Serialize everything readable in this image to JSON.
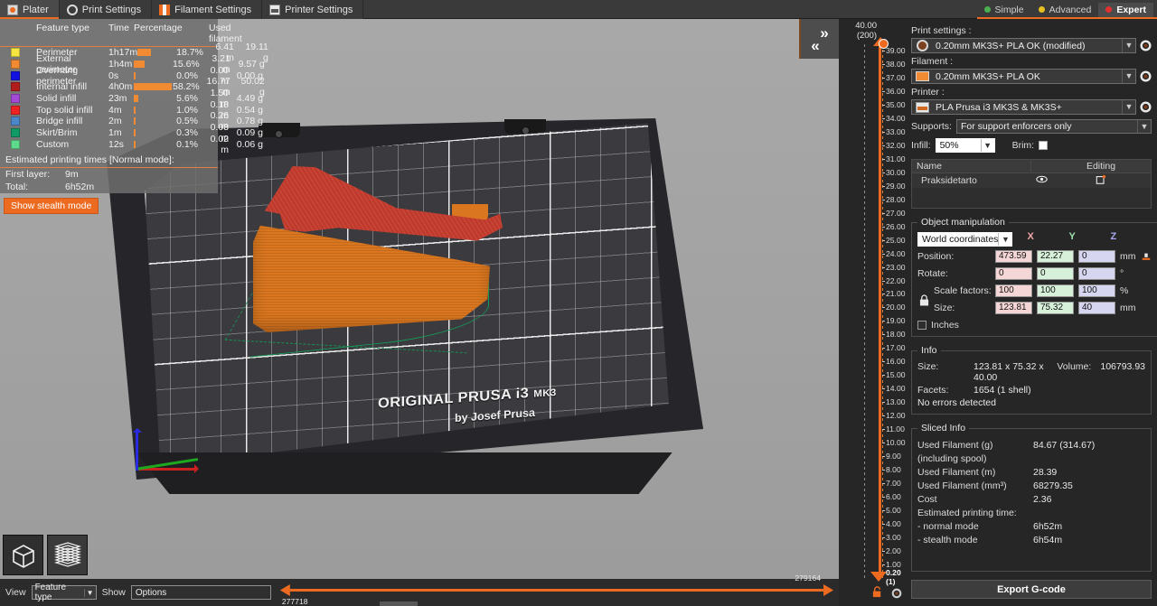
{
  "tabs": [
    {
      "label": "Plater",
      "icon": "plater-icon",
      "active": true
    },
    {
      "label": "Print Settings",
      "icon": "print-settings-icon",
      "active": false
    },
    {
      "label": "Filament Settings",
      "icon": "filament-settings-icon",
      "active": false
    },
    {
      "label": "Printer Settings",
      "icon": "printer-settings-icon",
      "active": false
    }
  ],
  "modes": [
    {
      "label": "Simple",
      "color": "#4caf50",
      "selected": false
    },
    {
      "label": "Advanced",
      "color": "#e8c020",
      "selected": false
    },
    {
      "label": "Expert",
      "color": "#e03030",
      "selected": true
    }
  ],
  "legend": {
    "headers": {
      "feature": "Feature type",
      "time": "Time",
      "percentage": "Percentage",
      "used": "Used filament"
    },
    "rows": [
      {
        "color": "#f5e642",
        "name": "Perimeter",
        "time": "1h17m",
        "pct": "18.7%",
        "bar": 18.7,
        "length": "6.41 m",
        "weight": "19.11 g"
      },
      {
        "color": "#f08b33",
        "name": "External perimeter",
        "time": "1h4m",
        "pct": "15.6%",
        "bar": 15.6,
        "length": "3.21 m",
        "weight": "9.57 g"
      },
      {
        "color": "#1212e0",
        "name": "Overhang perimeter",
        "time": "0s",
        "pct": "0.0%",
        "bar": 0.0,
        "length": "0.00 m",
        "weight": "0.00 g"
      },
      {
        "color": "#b11d1d",
        "name": "Internal infill",
        "time": "4h0m",
        "pct": "58.2%",
        "bar": 58.2,
        "length": "16.77 m",
        "weight": "50.02 g"
      },
      {
        "color": "#a24ad6",
        "name": "Solid infill",
        "time": "23m",
        "pct": "5.6%",
        "bar": 5.6,
        "length": "1.50 m",
        "weight": "4.49 g"
      },
      {
        "color": "#ee2222",
        "name": "Top solid infill",
        "time": "4m",
        "pct": "1.0%",
        "bar": 1.0,
        "length": "0.18 m",
        "weight": "0.54 g"
      },
      {
        "color": "#4a86c8",
        "name": "Bridge infill",
        "time": "2m",
        "pct": "0.5%",
        "bar": 0.5,
        "length": "0.26 m",
        "weight": "0.78 g"
      },
      {
        "color": "#119966",
        "name": "Skirt/Brim",
        "time": "1m",
        "pct": "0.3%",
        "bar": 0.3,
        "length": "0.03 m",
        "weight": "0.09 g"
      },
      {
        "color": "#5fd98a",
        "name": "Custom",
        "time": "12s",
        "pct": "0.1%",
        "bar": 0.1,
        "length": "0.02 m",
        "weight": "0.06 g"
      }
    ],
    "estimated_title": "Estimated printing times [Normal mode]:",
    "first_layer_label": "First layer:",
    "first_layer_value": "9m",
    "total_label": "Total:",
    "total_value": "6h52m",
    "stealth_button": "Show stealth mode"
  },
  "bed": {
    "logo_main": "ORIGINAL PRUSA i3",
    "logo_model": "MK3",
    "logo_sub": "by Josef Prusa"
  },
  "vslider": {
    "top_value": "40.00",
    "top_layer": "(200)",
    "bottom_value": "0.20",
    "bottom_layer": "(1)",
    "ticks": [
      "39.00",
      "38.00",
      "37.00",
      "36.00",
      "35.00",
      "34.00",
      "33.00",
      "32.00",
      "31.00",
      "30.00",
      "29.00",
      "28.00",
      "27.00",
      "26.00",
      "25.00",
      "24.00",
      "23.00",
      "22.00",
      "21.00",
      "20.00",
      "19.00",
      "18.00",
      "17.00",
      "16.00",
      "15.00",
      "14.00",
      "13.00",
      "12.00",
      "11.00",
      "10.00",
      "9.00",
      "8.00",
      "7.00",
      "6.00",
      "5.00",
      "4.00",
      "3.00",
      "2.00",
      "1.00"
    ]
  },
  "right": {
    "print_settings_label": "Print settings :",
    "print_settings_value": "0.20mm MK3S+ PLA OK (modified)",
    "filament_label": "Filament :",
    "filament_value": "0.20mm MK3S+ PLA OK",
    "printer_label": "Printer :",
    "printer_value": "PLA Prusa i3 MK3S & MK3S+",
    "supports_label": "Supports:",
    "supports_value": "For support enforcers only",
    "infill_label": "Infill:",
    "infill_value": "50%",
    "brim_label": "Brim:",
    "object_headers": {
      "name": "Name",
      "editing": "Editing"
    },
    "objects": [
      {
        "name": "Praksidetarto"
      }
    ]
  },
  "object_manipulation": {
    "title": "Object manipulation",
    "coord_system": "World coordinates",
    "axis_headers": [
      "X",
      "Y",
      "Z"
    ],
    "rows": [
      {
        "label": "Position:",
        "x": "473.59",
        "y": "22.27",
        "z": "0",
        "unit": "mm"
      },
      {
        "label": "Rotate:",
        "x": "0",
        "y": "0",
        "z": "0",
        "unit": "°"
      },
      {
        "label": "Scale factors:",
        "x": "100",
        "y": "100",
        "z": "100",
        "unit": "%"
      },
      {
        "label": "Size:",
        "x": "123.81",
        "y": "75.32",
        "z": "40",
        "unit": "mm"
      }
    ],
    "inches_label": "Inches"
  },
  "info": {
    "title": "Info",
    "size_label": "Size:",
    "size_value": "123.81 x 75.32 x 40.00",
    "volume_label": "Volume:",
    "volume_value": "106793.93",
    "facets_label": "Facets:",
    "facets_value": "1654 (1 shell)",
    "errors": "No errors detected"
  },
  "sliced_info": {
    "title": "Sliced Info",
    "rows": [
      {
        "k": "Used Filament (g)",
        "v": "84.67 (314.67)"
      },
      {
        "k": "    (including spool)",
        "v": ""
      },
      {
        "k": "Used Filament (m)",
        "v": "28.39"
      },
      {
        "k": "Used Filament (mm³)",
        "v": "68279.35"
      },
      {
        "k": "Cost",
        "v": "2.36"
      },
      {
        "k": "Estimated printing time:",
        "v": ""
      },
      {
        "k": "  - normal mode",
        "v": "6h52m"
      },
      {
        "k": "  - stealth mode",
        "v": "6h54m"
      }
    ],
    "export_button": "Export G-code"
  },
  "bottom": {
    "view_label": "View",
    "view_value": "Feature type",
    "show_label": "Show",
    "show_value": "Options",
    "slider_left_value": "277718",
    "slider_right_value": "279164"
  }
}
